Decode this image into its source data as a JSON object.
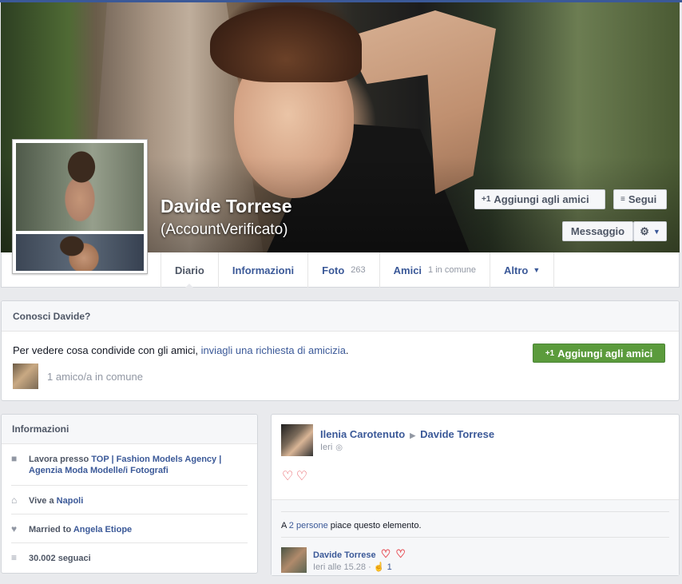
{
  "profile": {
    "name": "Davide Torrese",
    "subtitle": "(AccountVerificato)",
    "buttons": {
      "add_friend": "Aggiungi agli amici",
      "follow": "Segui",
      "message": "Messaggio",
      "add_icon": "+1",
      "follow_icon": "rss-icon",
      "gear_icon": "gear-icon"
    }
  },
  "tabs": [
    {
      "label": "Diario",
      "count": ""
    },
    {
      "label": "Informazioni",
      "count": ""
    },
    {
      "label": "Foto",
      "count": "263"
    },
    {
      "label": "Amici",
      "count": "1 in comune"
    },
    {
      "label": "Altro",
      "count": ""
    }
  ],
  "know_box": {
    "title": "Conosci Davide?",
    "text_before": "Per vedere cosa condivide con gli amici, ",
    "text_link": "inviagli una richiesta di amicizia",
    "text_after": ".",
    "button": "Aggiungi agli amici",
    "mutual": "1 amico/a in comune"
  },
  "info": {
    "title": "Informazioni",
    "work_prefix": "Lavora presso ",
    "work_link": "TOP | Fashion Models Agency | Agenzia Moda Modelle/i Fotografi",
    "lives_prefix": "Vive a ",
    "lives_link": "Napoli",
    "married_prefix": "Married to ",
    "married_link": "Angela Etiope",
    "followers": "30.002 seguaci"
  },
  "post": {
    "author": "Ilenia Carotenuto",
    "target": "Davide Torrese",
    "time": "Ieri",
    "likes_prefix": "A ",
    "likes_link": "2 persone",
    "likes_suffix": " piace questo elemento.",
    "comment": {
      "author": "Davide Torrese",
      "time": "Ieri alle 15.28",
      "likes": "1"
    }
  },
  "colors": {
    "brand": "#3b5998",
    "green_button": "#5b9b3c",
    "heart": "#e64a52",
    "background": "#e9eaed"
  }
}
